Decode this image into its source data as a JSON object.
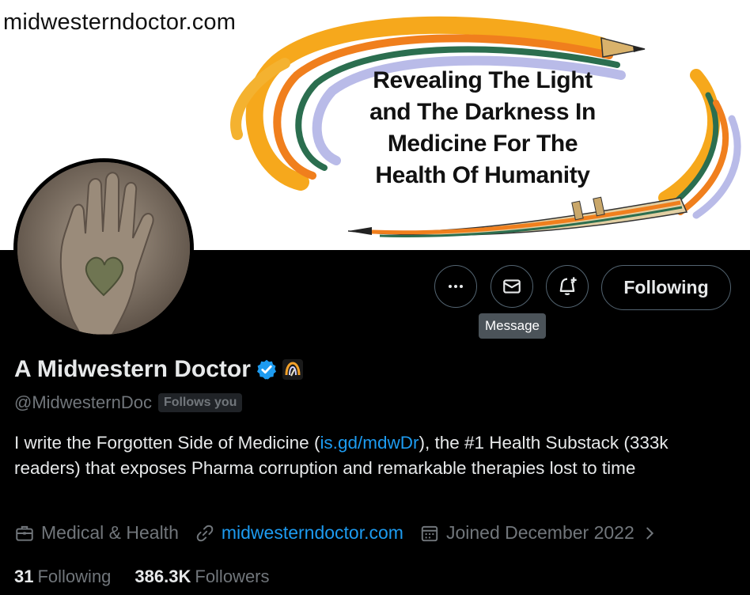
{
  "banner": {
    "site_text": "midwesterndoctor.com",
    "tagline_lines": [
      "Revealing The Light",
      "and The Darkness In",
      "Medicine For The",
      "Health Of Humanity"
    ]
  },
  "actions": {
    "more_icon": "more-dots-icon",
    "message_icon": "envelope-icon",
    "notify_icon": "bell-plus-icon",
    "following_label": "Following",
    "tooltip_label": "Message"
  },
  "profile": {
    "name": "A Midwestern Doctor",
    "handle": "@MidwesternDoc",
    "follows_you_label": "Follows you",
    "bio_before": "I write the Forgotten Side of Medicine (",
    "bio_link": "is.gd/mdwDr",
    "bio_after": "), the #1 Health Substack (333k readers) that exposes Pharma corruption and remarkable therapies lost to time",
    "category": "Medical & Health",
    "website": "midwesterndoctor.com",
    "joined": "Joined December 2022"
  },
  "stats": {
    "following_count": "31",
    "following_label": "Following",
    "followers_count": "386.3K",
    "followers_label": "Followers"
  },
  "colors": {
    "accent": "#1d9bf0",
    "muted": "#71767b",
    "border": "#536471",
    "text": "#e7e9ea"
  }
}
